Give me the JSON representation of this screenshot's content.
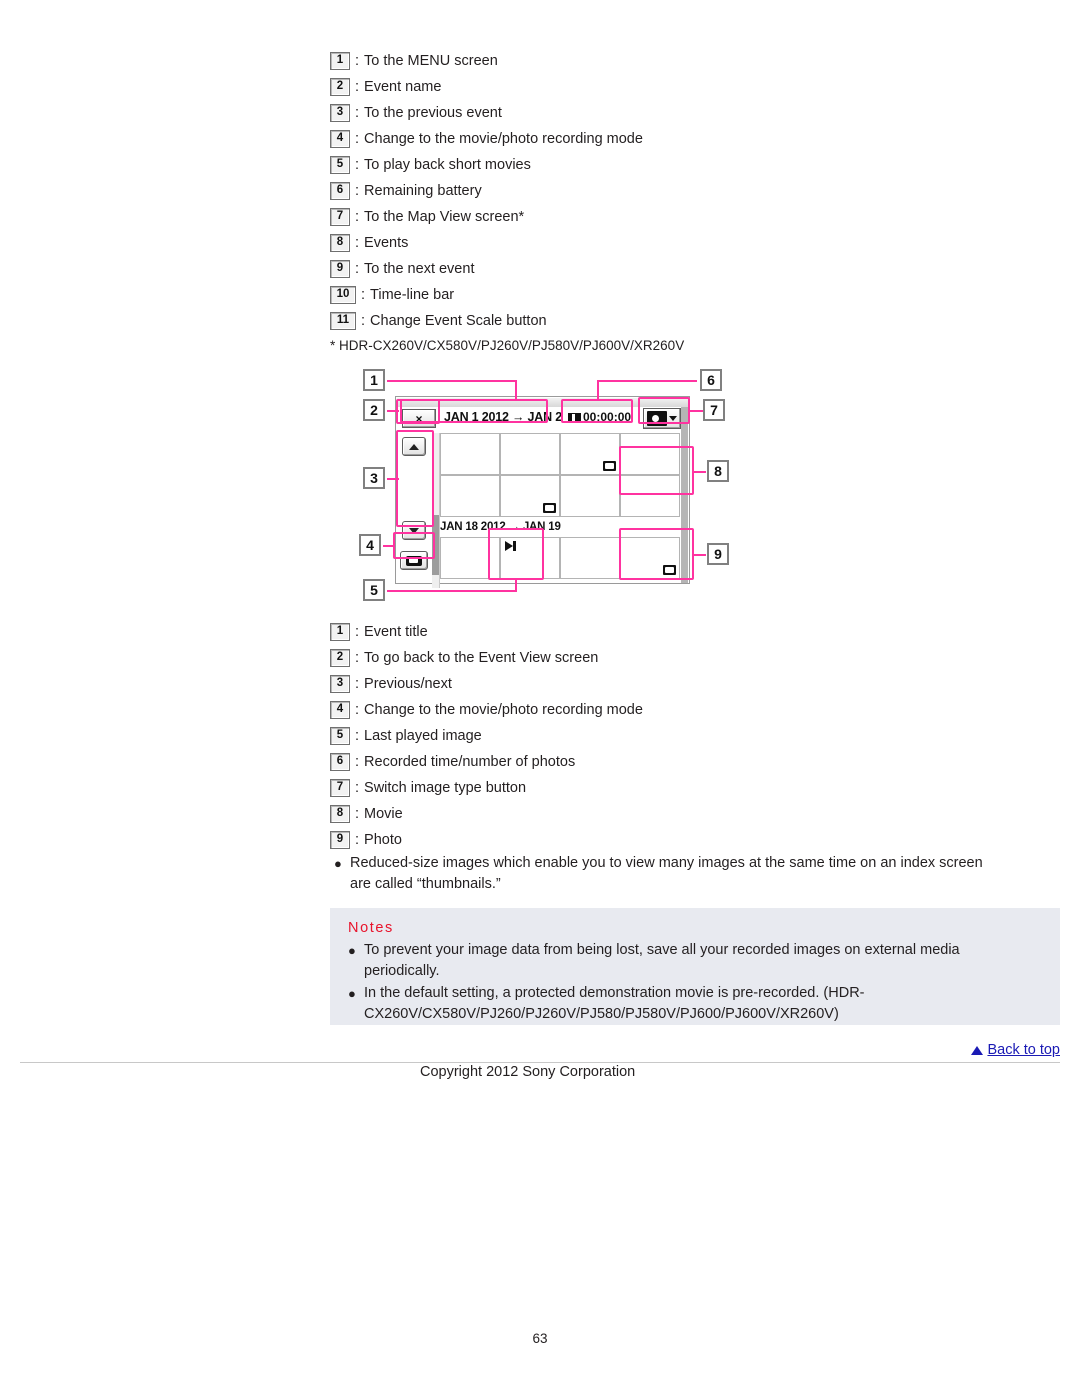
{
  "legend_top": [
    {
      "num": "1",
      "text": "To the MENU screen"
    },
    {
      "num": "2",
      "text": "Event name"
    },
    {
      "num": "3",
      "text": "To the previous event"
    },
    {
      "num": "4",
      "text": "Change to the movie/photo recording mode"
    },
    {
      "num": "5",
      "text": "To play back short movies"
    },
    {
      "num": "6",
      "text": "Remaining battery"
    },
    {
      "num": "7",
      "text": "To the Map View screen*"
    },
    {
      "num": "8",
      "text": "Events"
    },
    {
      "num": "9",
      "text": "To the next event"
    },
    {
      "num": "10",
      "text": "Time-line bar"
    },
    {
      "num": "11",
      "text": "Change Event Scale button"
    }
  ],
  "separator": ":",
  "footnote": "* HDR-CX260V/CX580V/PJ260V/PJ580V/PJ600V/XR260V",
  "diagram": {
    "event_title": "JAN 1 2012 → JAN 2",
    "event_title_2": "JAN 18 2012 → JAN 19",
    "recorded_time": "00:00:00",
    "close_label": "×",
    "callouts_left": [
      "1",
      "2",
      "3",
      "4",
      "5"
    ],
    "callouts_right": [
      "6",
      "7",
      "8",
      "9"
    ],
    "highlight_color": "#ff33a0"
  },
  "legend_bottom": [
    {
      "num": "1",
      "text": "Event title"
    },
    {
      "num": "2",
      "text": "To go back to the Event View screen"
    },
    {
      "num": "3",
      "text": "Previous/next"
    },
    {
      "num": "4",
      "text": "Change to the movie/photo recording mode"
    },
    {
      "num": "5",
      "text": "Last played image"
    },
    {
      "num": "6",
      "text": "Recorded time/number of photos"
    },
    {
      "num": "7",
      "text": "Switch image type button"
    },
    {
      "num": "8",
      "text": "Movie"
    },
    {
      "num": "9",
      "text": "Photo"
    }
  ],
  "tip_bullet": {
    "marker": "●",
    "line1": "Reduced-size images which enable you to view many images at the same time on an index screen",
    "line2": "are called “thumbnails.”"
  },
  "notes": {
    "title": "Notes",
    "marker": "●",
    "items": [
      {
        "line1": "To prevent your image data from being lost, save all your recorded images on external media",
        "line2": "periodically."
      },
      {
        "line1": "In the default setting, a protected demonstration movie is pre-recorded. (HDR-",
        "line2": "CX260V/CX580V/PJ260/PJ260V/PJ580/PJ580V/PJ600/PJ600V/XR260V)"
      }
    ],
    "background": "#e8eaf0",
    "title_color": "#e8132b"
  },
  "footer": {
    "back_to_top": "Back to top",
    "copyright": "Copyright 2012 Sony Corporation",
    "page_number": "63",
    "link_color": "#1a1ab4"
  }
}
